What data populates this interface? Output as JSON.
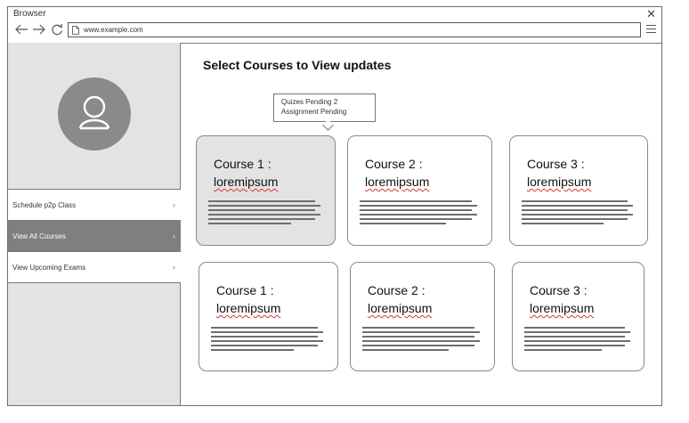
{
  "browser": {
    "title": "Browser",
    "close_glyph": "✕",
    "address": "www.example.com",
    "icons": [
      "back-arrow-icon",
      "forward-arrow-icon",
      "refresh-icon",
      "document-icon",
      "hamburger-menu-icon"
    ]
  },
  "sidebar": {
    "avatar_icon": "user-icon",
    "items": [
      {
        "label": "Schedule p2p Class",
        "active": false
      },
      {
        "label": "View All Courses",
        "active": true
      },
      {
        "label": "View Upcoming Exams",
        "active": false
      }
    ],
    "chevron_glyph": "›"
  },
  "main": {
    "heading": "Select Courses to View updates",
    "tooltip": {
      "line1": "Quizes Pending 2",
      "line2": "Assignment Pending"
    },
    "cards": [
      {
        "title": "Course 1 :",
        "subtitle": "loremipsum",
        "highlighted": true
      },
      {
        "title": "Course 2 :",
        "subtitle": "loremipsum",
        "highlighted": false
      },
      {
        "title": "Course 3 :",
        "subtitle": "loremipsum",
        "highlighted": false
      },
      {
        "title": "Course 1 :",
        "subtitle": "loremipsum",
        "highlighted": false
      },
      {
        "title": "Course 2 :",
        "subtitle": "loremipsum",
        "highlighted": false
      },
      {
        "title": "Course 3 :",
        "subtitle": "loremipsum",
        "highlighted": false
      }
    ]
  }
}
